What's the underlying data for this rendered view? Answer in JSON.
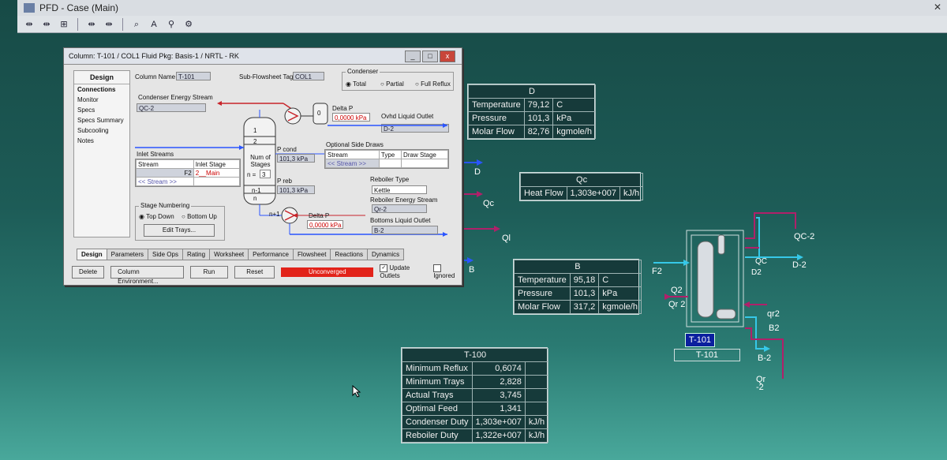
{
  "window": {
    "title": "PFD - Case (Main)",
    "close": "✕"
  },
  "toolbar": {
    "icons": [
      "⇹",
      "⇹",
      "⊞",
      "⇹",
      "⇹",
      "⌕",
      "A",
      "⚲",
      "⚙"
    ]
  },
  "dialog": {
    "title": "Column: T-101 / COL1  Fluid Pkg: Basis-1 / NRTL - RK",
    "nav_header": "Design",
    "nav_items": [
      "Connections",
      "Monitor",
      "Specs",
      "Specs Summary",
      "Subcooling",
      "Notes"
    ],
    "column_name_label": "Column Name",
    "column_name": "T-101",
    "subflowsheet_label": "Sub-Flowsheet Tag",
    "subflowsheet_tag": "COL1",
    "condenser_label": "Condenser",
    "condenser_options": [
      "Total",
      "Partial",
      "Full Reflux"
    ],
    "condenser_energy_label": "Condenser Energy Stream",
    "condenser_energy_value": "QC-2",
    "delta_p_label": "Delta P",
    "delta_p_top": "0,0000 kPa",
    "ovhd_label": "Ovhd Liquid Outlet",
    "ovhd_value": "D-2",
    "condenser_drum_label": "0",
    "stage_1": "1",
    "stage_2": "2",
    "num_stages_label": "Num of Stages",
    "n_label": "n =",
    "n_value": "3",
    "stage_n1": "n-1",
    "stage_n": "n",
    "stage_np1": "n+1",
    "p_cond_label": "P cond",
    "p_cond_value": "101,3 kPa",
    "p_reb_label": "P reb",
    "p_reb_value": "101,3 kPa",
    "inlet_streams_label": "Inlet Streams",
    "inlet_headers": [
      "Stream",
      "Inlet Stage"
    ],
    "inlet_rows": [
      [
        "F2",
        "2__Main"
      ],
      [
        "<< Stream >>",
        ""
      ]
    ],
    "side_draws_label": "Optional Side Draws",
    "side_headers": [
      "Stream",
      "Type",
      "Draw Stage"
    ],
    "side_rows": [
      [
        "<< Stream >>",
        "",
        ""
      ]
    ],
    "reboiler_type_label": "Reboiler Type",
    "reboiler_type": "Kettle",
    "reboiler_energy_label": "Reboiler Energy Stream",
    "reboiler_energy_value": "Qr-2",
    "bottoms_label": "Bottoms Liquid Outlet",
    "bottoms_value": "B-2",
    "delta_p_bottom": "0,0000 kPa",
    "stage_numbering_label": "Stage Numbering",
    "stage_numbering_options": [
      "Top Down",
      "Bottom Up"
    ],
    "edit_trays": "Edit Trays...",
    "tabs": [
      "Design",
      "Parameters",
      "Side Ops",
      "Rating",
      "Worksheet",
      "Performance",
      "Flowsheet",
      "Reactions",
      "Dynamics"
    ],
    "buttons": {
      "delete": "Delete",
      "column_env": "Column Environment...",
      "run": "Run",
      "reset": "Reset"
    },
    "status": "Unconverged",
    "update_outlets": "Update Outlets",
    "ignored": "Ignored",
    "check_mark": "✓"
  },
  "panel_D": {
    "title": "D",
    "rows": [
      [
        "Temperature",
        "79,12",
        "C"
      ],
      [
        "Pressure",
        "101,3",
        "kPa"
      ],
      [
        "Molar Flow",
        "82,76",
        "kgmole/h"
      ]
    ]
  },
  "panel_Qc": {
    "title": "Qc",
    "rows": [
      [
        "Heat Flow",
        "1,303e+007",
        "kJ/h"
      ]
    ]
  },
  "panel_B": {
    "title": "B",
    "rows": [
      [
        "Temperature",
        "95,18",
        "C"
      ],
      [
        "Pressure",
        "101,3",
        "kPa"
      ],
      [
        "Molar Flow",
        "317,2",
        "kgmole/h"
      ]
    ]
  },
  "panel_T100": {
    "title": "T-100",
    "rows": [
      [
        "Minimum Reflux",
        "0,6074",
        ""
      ],
      [
        "Minimum Trays",
        "2,828",
        ""
      ],
      [
        "Actual Trays",
        "3,745",
        ""
      ],
      [
        "Optimal Feed",
        "1,341",
        ""
      ],
      [
        "Condenser Duty",
        "1,303e+007",
        "kJ/h"
      ],
      [
        "Reboiler Duty",
        "1,322e+007",
        "kJ/h"
      ]
    ]
  },
  "streams": {
    "D": "D",
    "Qc": "Qc",
    "Ql": "Ql",
    "B": "B",
    "F2": "F2",
    "Q2": "Q2",
    "Qr2": "Qr 2",
    "QC2": "QC-2",
    "QC": "QC",
    "D2small": "D2",
    "D2": "D-2",
    "qr2": "qr2",
    "B2small": "B2",
    "B2": "B-2",
    "Qrm2": "Qr\n-2"
  },
  "t101": {
    "tag": "T-101",
    "label": "T-101"
  }
}
